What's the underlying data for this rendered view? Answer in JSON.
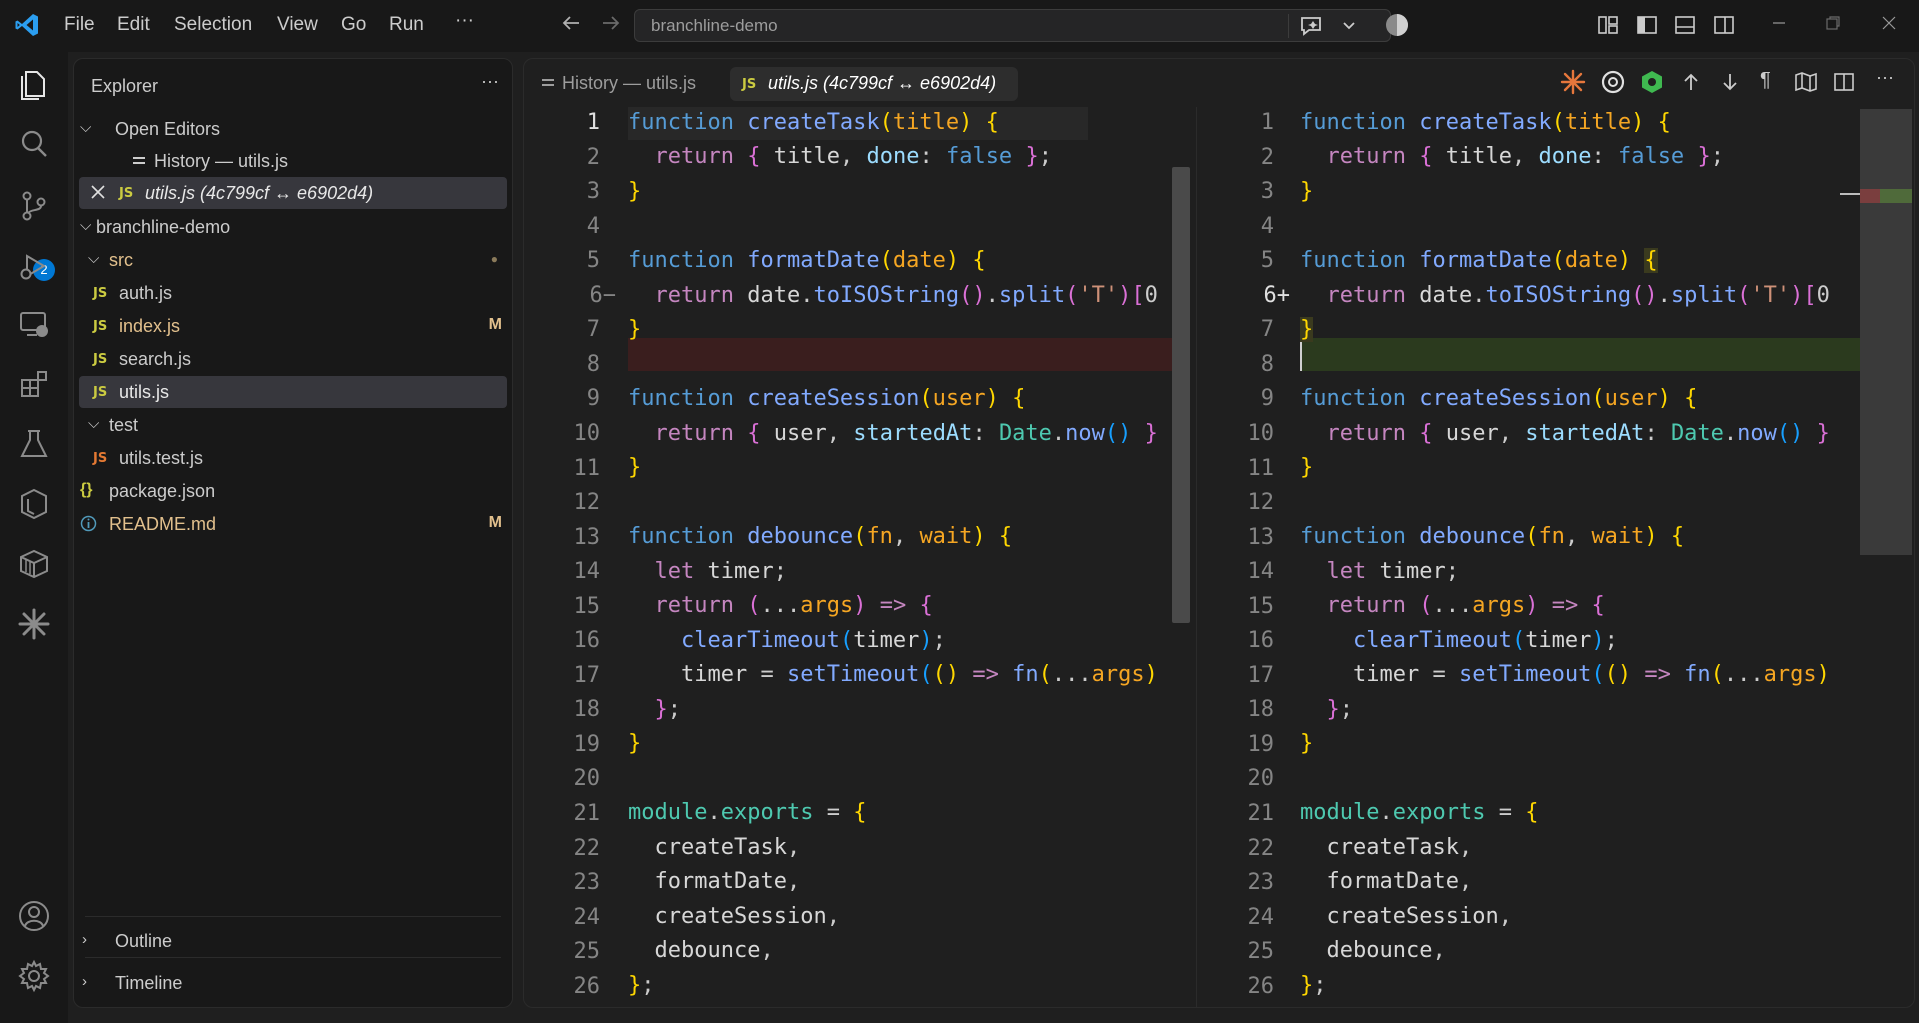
{
  "titlebar": {
    "menus": [
      "File",
      "Edit",
      "Selection",
      "View",
      "Go",
      "Run",
      "···"
    ],
    "search_text": "branchline-demo"
  },
  "activitybar": {
    "icons": [
      "explorer-icon",
      "search-icon",
      "source-control-icon",
      "run-debug-icon",
      "remote-explorer-icon",
      "extensions-icon",
      "testing-icon",
      "docker-icon",
      "package-icon",
      "sparkle-icon",
      "account-icon",
      "gear-icon"
    ],
    "source_control_badge": "2"
  },
  "sidebar": {
    "title": "Explorer",
    "more": "···",
    "open_editors_label": "Open Editors",
    "open_editors": [
      {
        "label": "History — utils.js"
      },
      {
        "label": "utils.js (4c799cf ↔ e6902d4)"
      }
    ],
    "workspace_label": "branchline-demo",
    "tree": [
      {
        "label": "src",
        "kind": "folder",
        "status": "●"
      },
      {
        "label": "auth.js",
        "kind": "js",
        "status": ""
      },
      {
        "label": "index.js",
        "kind": "js",
        "status": "M"
      },
      {
        "label": "search.js",
        "kind": "js",
        "status": ""
      },
      {
        "label": "utils.js",
        "kind": "js",
        "status": ""
      },
      {
        "label": "test",
        "kind": "folder",
        "status": ""
      },
      {
        "label": "utils.test.js",
        "kind": "js",
        "status": ""
      },
      {
        "label": "package.json",
        "kind": "json",
        "status": ""
      },
      {
        "label": "README.md",
        "kind": "md",
        "status": "M"
      }
    ],
    "outline_label": "Outline",
    "timeline_label": "Timeline"
  },
  "editor": {
    "tabs": [
      {
        "label": "History — utils.js",
        "active": false
      },
      {
        "label": "utils.js (4c799cf ↔ e6902d4)",
        "active": true
      }
    ],
    "js_badge": "JS",
    "more": "···",
    "left_markers": {
      "6": "6−"
    },
    "right_markers": {
      "6": "6+"
    },
    "line_numbers": [
      "1",
      "2",
      "3",
      "4",
      "5",
      "6",
      "7",
      "8",
      "9",
      "10",
      "11",
      "12",
      "13",
      "14",
      "15",
      "16",
      "17",
      "18",
      "19",
      "20",
      "21",
      "22",
      "23",
      "24",
      "25",
      "26"
    ]
  }
}
